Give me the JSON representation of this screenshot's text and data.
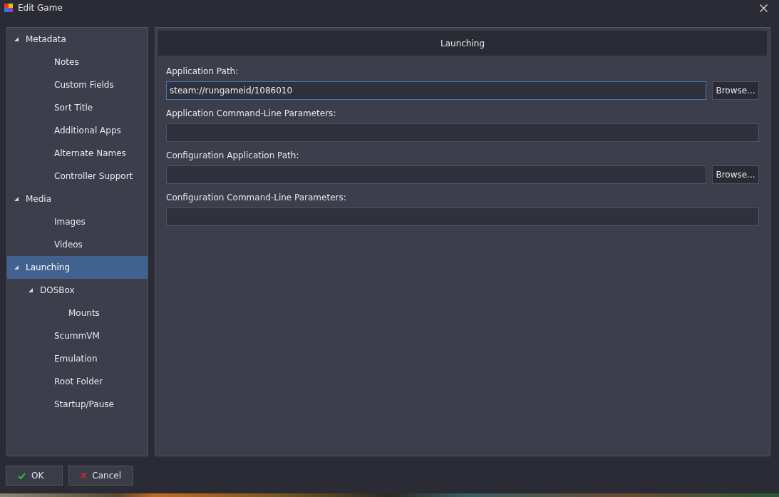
{
  "window": {
    "title": "Edit Game"
  },
  "sidebar": {
    "items": [
      {
        "label": "Metadata",
        "selected": false,
        "expanded": true,
        "children": [
          {
            "label": "Notes",
            "selected": false
          },
          {
            "label": "Custom Fields",
            "selected": false
          },
          {
            "label": "Sort Title",
            "selected": false
          },
          {
            "label": "Additional Apps",
            "selected": false
          },
          {
            "label": "Alternate Names",
            "selected": false
          },
          {
            "label": "Controller Support",
            "selected": false
          }
        ]
      },
      {
        "label": "Media",
        "selected": false,
        "expanded": true,
        "children": [
          {
            "label": "Images",
            "selected": false
          },
          {
            "label": "Videos",
            "selected": false
          }
        ]
      },
      {
        "label": "Launching",
        "selected": true,
        "expanded": true,
        "children": [
          {
            "label": "DOSBox",
            "selected": false,
            "expanded": true,
            "children": [
              {
                "label": "Mounts",
                "selected": false
              }
            ]
          },
          {
            "label": "ScummVM",
            "selected": false
          },
          {
            "label": "Emulation",
            "selected": false
          },
          {
            "label": "Root Folder",
            "selected": false
          },
          {
            "label": "Startup/Pause",
            "selected": false
          }
        ]
      }
    ]
  },
  "panel": {
    "title": "Launching",
    "fields": [
      {
        "label": "Application Path:",
        "value": "steam://rungameid/1086010",
        "focused": true,
        "button": "Browse..."
      },
      {
        "label": "Application Command-Line Parameters:",
        "focused": false
      },
      {
        "label": "Configuration Application Path:",
        "focused": false,
        "button": "Browse..."
      },
      {
        "label": "Configuration Command-Line Parameters:",
        "focused": false
      }
    ]
  },
  "buttons": [
    {
      "kind": "ok",
      "label": "OK"
    },
    {
      "kind": "cancel",
      "label": "Cancel"
    }
  ]
}
